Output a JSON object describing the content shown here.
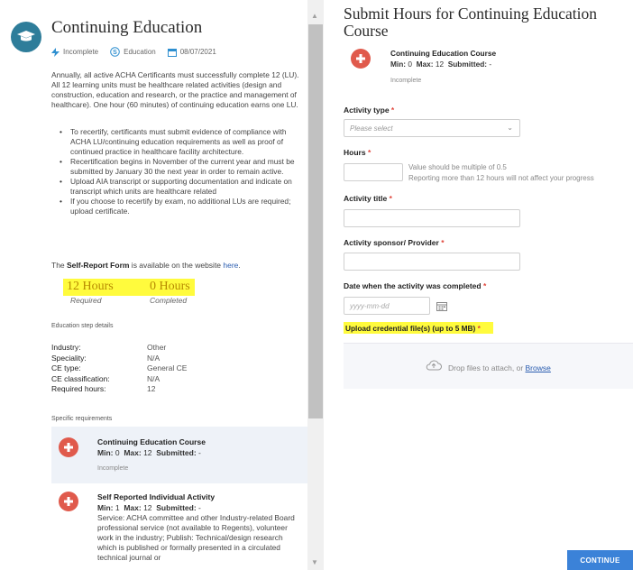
{
  "left": {
    "title": "Continuing Education",
    "meta": {
      "status": "Incomplete",
      "category": "Education",
      "date": "08/07/2021"
    },
    "description": "Annually, all active ACHA Certificants must successfully complete 12 (LU). All 12 learning units must be healthcare related activities (design and construction, education and research, or the practice and management of healthcare). One hour (60 minutes) of continuing education earns one LU.",
    "bullets": [
      "To recertify, certificants must submit evidence of compliance with ACHA LU/continuing education requirements as well as proof of continued practice in healthcare facility architecture.",
      "Recertification begins in November of the current year and must be submitted by January 30 the next year in order to remain active.",
      "Upload AIA transcript or supporting documentation and indicate on transcript which units are healthcare related",
      "If you choose to recertify by exam, no additional LUs are required; upload certificate."
    ],
    "self_report": {
      "prefix": "The ",
      "bold": "Self-Report Form",
      "middle": " is available on the website ",
      "link": "here",
      "suffix": "."
    },
    "stats": {
      "required_value": "12 Hours",
      "required_label": "Required",
      "completed_value": "0 Hours",
      "completed_label": "Completed"
    },
    "step_details_heading": "Education step details",
    "details": [
      {
        "key": "Industry:",
        "value": "Other"
      },
      {
        "key": "Speciality:",
        "value": "N/A"
      },
      {
        "key": "CE type:",
        "value": "General CE"
      },
      {
        "key": "CE classification:",
        "value": "N/A"
      },
      {
        "key": "Required hours:",
        "value": "12"
      }
    ],
    "specific_heading": "Specific requirements",
    "requirements": [
      {
        "title": "Continuing Education Course",
        "min_label": "Min:",
        "min": "0",
        "max_label": "Max:",
        "max": "12",
        "submitted_label": "Submitted:",
        "submitted": "-",
        "status": "Incomplete"
      },
      {
        "title": "Self Reported Individual Activity",
        "min_label": "Min:",
        "min": "1",
        "max_label": "Max:",
        "max": "12",
        "submitted_label": "Submitted:",
        "submitted": "-",
        "description": "Service: ACHA committee and other Industry-related Board professional service (not available to Regents), volunteer work in the industry; Publish: Technical/design research which is published or formally presented in a circulated technical journal or"
      }
    ]
  },
  "right": {
    "title": "Submit Hours for Continuing Education Course",
    "course": {
      "title": "Continuing Education Course",
      "min_label": "Min:",
      "min": "0",
      "max_label": "Max:",
      "max": "12",
      "submitted_label": "Submitted:",
      "submitted": "-",
      "status": "Incomplete"
    },
    "form": {
      "activity_type_label": "Activity type",
      "activity_type_placeholder": "Please select",
      "hours_label": "Hours",
      "hours_hint_1": "Value should be multiple of 0.5",
      "hours_hint_2": "Reporting more than 12 hours will not affect your progress",
      "activity_title_label": "Activity title",
      "sponsor_label": "Activity sponsor/ Provider",
      "date_label": "Date when the activity was completed",
      "date_placeholder": "yyyy-mm-dd",
      "upload_label": "Upload credential file(s) (up to 5 MB)",
      "required_mark": "*",
      "drop_text": "Drop files to attach, or ",
      "browse": "Browse"
    },
    "continue_label": "CONTINUE"
  },
  "colors": {
    "accent": "#3b82d8",
    "highlight": "#fffb3d",
    "badge_red": "#e05a4c",
    "cap_teal": "#2e7d9a"
  }
}
